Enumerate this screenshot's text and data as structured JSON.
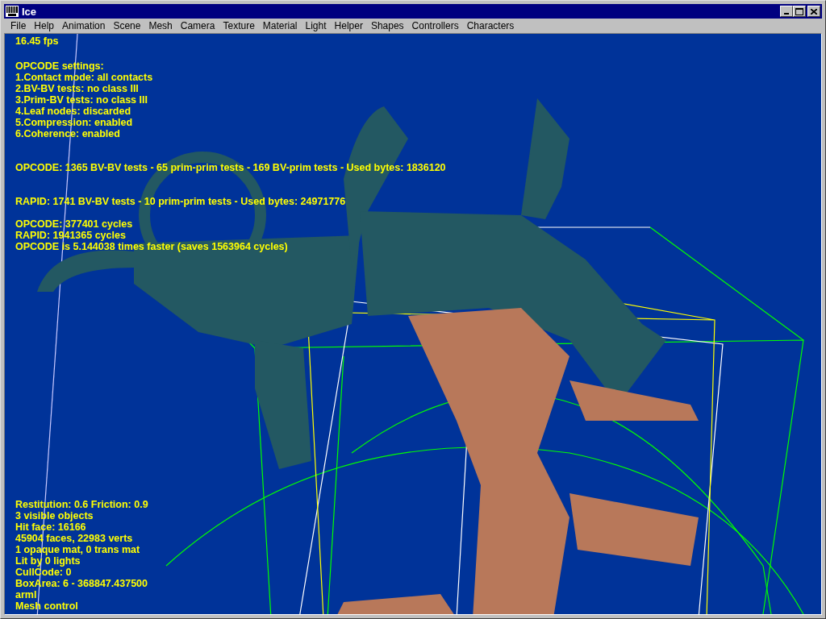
{
  "window": {
    "title": "Ice"
  },
  "menu": [
    "File",
    "Help",
    "Animation",
    "Scene",
    "Mesh",
    "Camera",
    "Texture",
    "Material",
    "Light",
    "Helper",
    "Shapes",
    "Controllers",
    "Characters"
  ],
  "hud": {
    "fps": "16.45 fps",
    "settings_title": "OPCODE settings:",
    "settings": [
      "1.Contact mode: all contacts",
      "2.BV-BV tests: no class III",
      "3.Prim-BV tests: no class III",
      "4.Leaf nodes: discarded",
      "5.Compression: enabled",
      "6.Coherence: enabled"
    ],
    "opcode_stats": "OPCODE: 1365 BV-BV tests - 65 prim-prim tests - 169 BV-prim tests - Used bytes: 1836120",
    "rapid_stats": "RAPID: 1741 BV-BV tests - 10 prim-prim tests - Used bytes: 24971776",
    "cycles": [
      "OPCODE: 377401 cycles",
      "RAPID: 1941365 cycles",
      "OPCODE is 5.144038 times faster (saves 1563964 cycles)"
    ],
    "scene_info": [
      "Restitution: 0.6  Friction: 0.9",
      "3 visible objects",
      "Hit face: 16166",
      "45904 faces, 22983 verts",
      "1 opaque mat, 0 trans mat",
      "Lit by 0 lights",
      "CullCode: 0",
      "BoxArea: 6 - 368847.437500",
      "arml",
      "Mesh control"
    ]
  }
}
